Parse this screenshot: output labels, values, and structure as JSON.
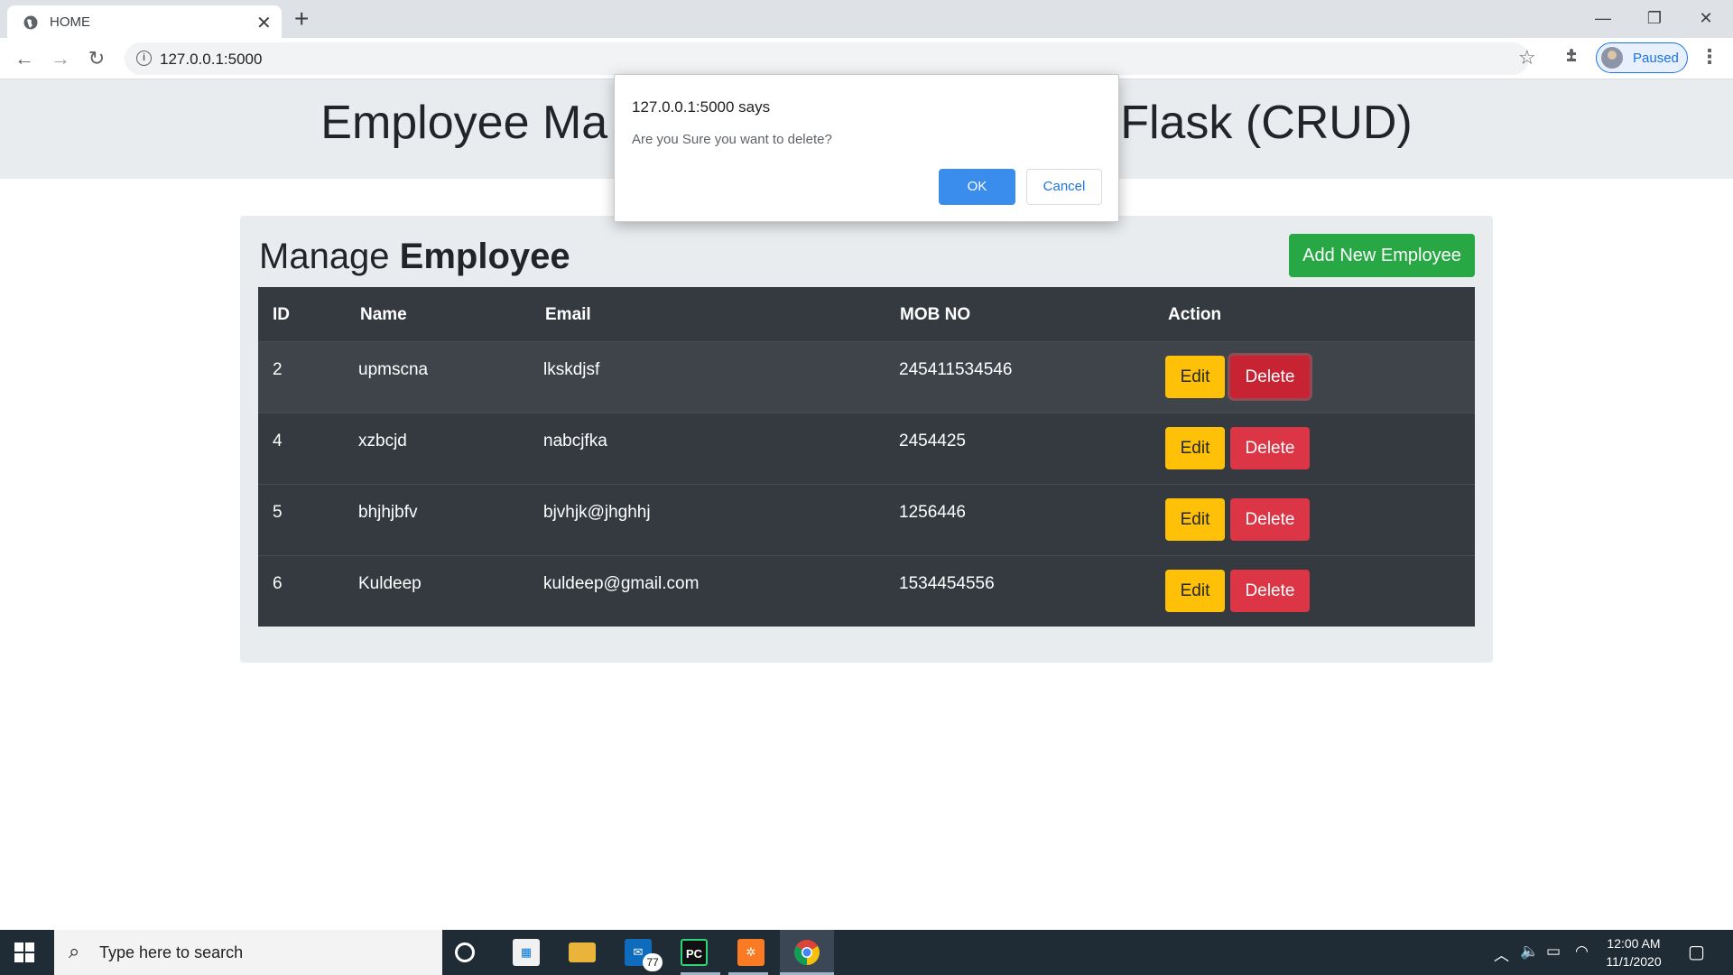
{
  "browser": {
    "tab_title": "HOME",
    "url": "127.0.0.1:5000",
    "profile_label": "Paused"
  },
  "page": {
    "title": "Employee Management System Using Flask (CRUD)",
    "title_visible_left": "Employee Ma",
    "title_visible_right": "Flask (CRUD)",
    "manage_prefix": "Manage ",
    "manage_bold": "Employee",
    "add_button": "Add New Employee"
  },
  "table": {
    "headers": [
      "ID",
      "Name",
      "Email",
      "MOB NO",
      "Action"
    ],
    "rows": [
      {
        "id": "2",
        "name": "upmscna",
        "email": "lkskdjsf",
        "mob": "245411534546"
      },
      {
        "id": "4",
        "name": "xzbcjd",
        "email": "nabcjfka",
        "mob": "2454425"
      },
      {
        "id": "5",
        "name": "bhjhjbfv",
        "email": "bjvhjk@jhghhj",
        "mob": "1256446"
      },
      {
        "id": "6",
        "name": "Kuldeep",
        "email": "kuldeep@gmail.com",
        "mob": "1534454556"
      }
    ],
    "edit_label": "Edit",
    "delete_label": "Delete"
  },
  "dialog": {
    "title": "127.0.0.1:5000 says",
    "message": "Are you Sure you want to delete?",
    "ok": "OK",
    "cancel": "Cancel"
  },
  "taskbar": {
    "search_placeholder": "Type here to search",
    "mail_badge": "77",
    "time": "12:00 AM",
    "date": "11/1/2020"
  },
  "colors": {
    "success": "#28a745",
    "warning": "#ffc107",
    "danger": "#dc3545",
    "table_dark": "#343a40",
    "dialog_ok": "#1a73e8"
  }
}
